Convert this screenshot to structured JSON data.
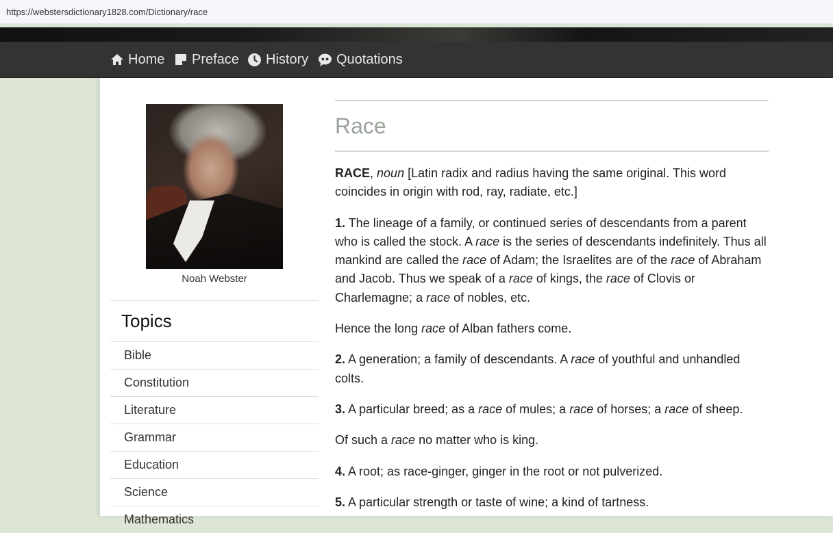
{
  "browser": {
    "url": "https://webstersdictionary1828.com/Dictionary/race"
  },
  "nav": {
    "items": [
      {
        "label": "Home",
        "icon": "home-icon"
      },
      {
        "label": "Preface",
        "icon": "note-icon"
      },
      {
        "label": "History",
        "icon": "clock-icon"
      },
      {
        "label": "Quotations",
        "icon": "quote-icon"
      }
    ]
  },
  "sidebar": {
    "caption": "Noah Webster",
    "topics_title": "Topics",
    "topics": [
      "Bible",
      "Constitution",
      "Literature",
      "Grammar",
      "Education",
      "Science",
      "Mathematics"
    ]
  },
  "entry": {
    "title": "Race",
    "head_word": "RACE",
    "head_pos": "noun",
    "head_text": " [Latin radix and radius having the same original. This word coincides in origin with rod, ray, radiate, etc.]",
    "def1_num": "1.",
    "def1_a": " The lineage of a family, or continued series of descendants from a parent who is called the stock. A ",
    "def1_b": " is the series of descendants indefinitely. Thus all mankind are called the ",
    "def1_c": " of Adam; the Israelites are of the ",
    "def1_d": " of Abraham and Jacob. Thus we speak of a ",
    "def1_e": " of kings, the ",
    "def1_f": " of Clovis or Charlemagne; a ",
    "def1_g": " of nobles, etc.",
    "quote1_a": "Hence the long ",
    "quote1_b": " of Alban fathers come.",
    "def2_num": "2.",
    "def2_a": " A generation; a family of descendants. A ",
    "def2_b": " of youthful and unhandled colts.",
    "def3_num": "3.",
    "def3_a": " A particular breed; as a ",
    "def3_b": " of mules; a ",
    "def3_c": " of horses; a ",
    "def3_d": " of sheep.",
    "quote2_a": "Of such a ",
    "quote2_b": " no matter who is king.",
    "def4_num": "4.",
    "def4_a": " A root; as race-ginger, ginger in the root or not pulverized.",
    "def5_num": "5.",
    "def5_a": " A particular strength or taste of wine; a kind of tartness.",
    "word": "race"
  },
  "colors": {
    "navbar": "#333333",
    "title": "#9aa39a",
    "background": "#dde6d6"
  }
}
